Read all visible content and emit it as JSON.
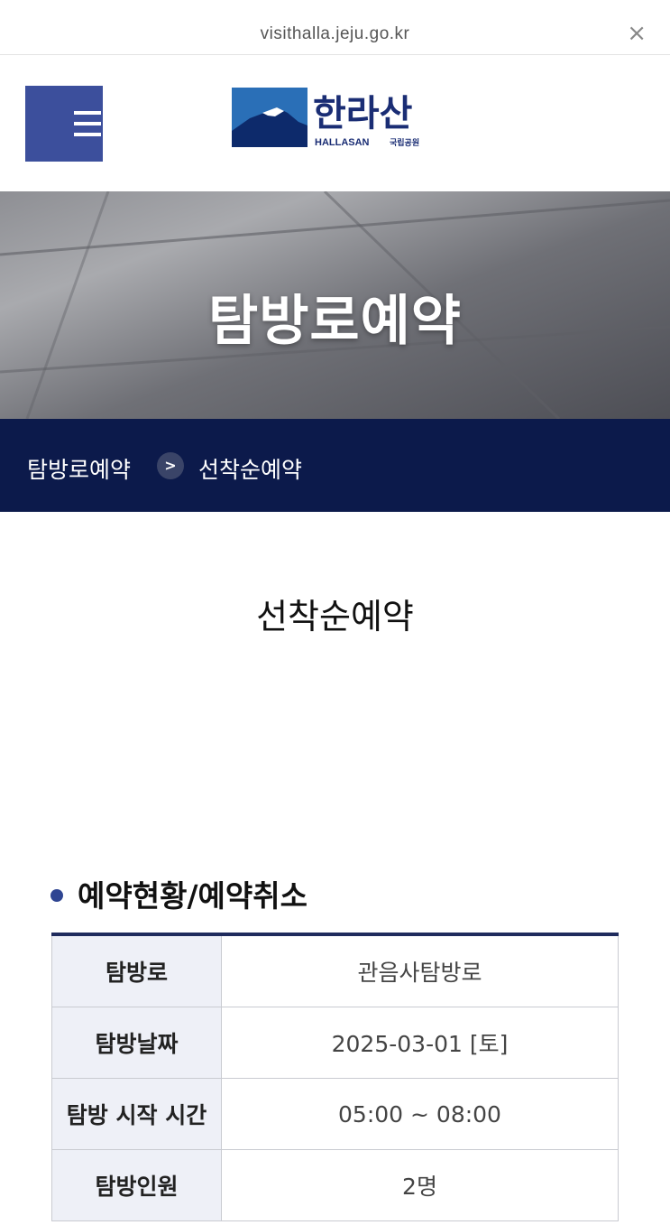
{
  "browser": {
    "url": "visithalla.jeju.go.kr",
    "close_glyph": "×"
  },
  "header": {
    "menu_icon": "hamburger-menu-icon",
    "logo": {
      "korean": "한라산",
      "english": "HALLASAN",
      "sub": "국립공원"
    }
  },
  "hero": {
    "title": "탐방로예약"
  },
  "breadcrumb": {
    "items": [
      "탐방로예약",
      "선착순예약"
    ],
    "separator_glyph": ">"
  },
  "page_title": "선착순예약",
  "section": {
    "heading": "예약현황/예약취소",
    "rows": [
      {
        "label": "탐방로",
        "value": "관음사탐방로"
      },
      {
        "label": "탐방날짜",
        "value": "2025-03-01 [토]"
      },
      {
        "label": "탐방 시작 시간",
        "value": "05:00 ~ 08:00"
      },
      {
        "label": "탐방인원",
        "value": "2명"
      }
    ]
  },
  "colors": {
    "navy": "#0c1a4b",
    "menu_blue": "#3c4f9c",
    "table_border": "#1f2b5d"
  }
}
